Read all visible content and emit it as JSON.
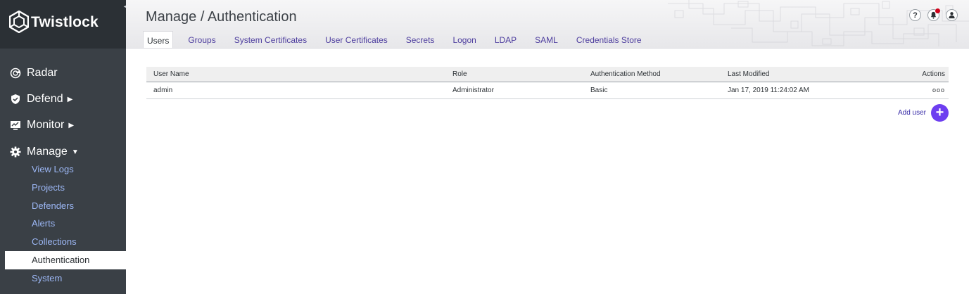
{
  "brand": {
    "name": "Twistlock"
  },
  "sidebar": {
    "collapse_glyph": "◀",
    "main": [
      {
        "label": "Radar",
        "icon": "radar-icon"
      },
      {
        "label": "Defend",
        "icon": "shield-icon",
        "caret": "▶"
      },
      {
        "label": "Monitor",
        "icon": "monitor-icon",
        "caret": "▶"
      },
      {
        "label": "Manage",
        "icon": "gear-icon",
        "caret": "▼"
      }
    ],
    "manage_items": [
      {
        "label": "View Logs"
      },
      {
        "label": "Projects"
      },
      {
        "label": "Defenders"
      },
      {
        "label": "Alerts"
      },
      {
        "label": "Collections"
      },
      {
        "label": "Authentication",
        "active": true
      },
      {
        "label": "System"
      }
    ]
  },
  "header": {
    "title": "Manage / Authentication",
    "tabs": [
      {
        "label": "Users",
        "active": true
      },
      {
        "label": "Groups"
      },
      {
        "label": "System Certificates"
      },
      {
        "label": "User Certificates"
      },
      {
        "label": "Secrets"
      },
      {
        "label": "Logon"
      },
      {
        "label": "LDAP"
      },
      {
        "label": "SAML"
      },
      {
        "label": "Credentials Store"
      }
    ],
    "icons": {
      "help": "?",
      "help_icon": "help-icon",
      "bell_icon": "bell-icon",
      "user_icon": "user-icon"
    }
  },
  "users_table": {
    "columns": [
      "User Name",
      "Role",
      "Authentication Method",
      "Last Modified",
      "Actions"
    ],
    "rows": [
      {
        "user": "admin",
        "role": "Administrator",
        "method": "Basic",
        "modified": "Jan 17, 2019 11:24:02 AM",
        "actions": "ooo"
      }
    ]
  },
  "add_user": {
    "label": "Add user",
    "glyph": "+"
  },
  "colors": {
    "sidebar": "#3a4046",
    "brand_bg": "#2b3035",
    "link": "#9cb7f5",
    "tab": "#4d3d9e",
    "accent": "#6d3ef0",
    "notif": "#d0021b"
  }
}
